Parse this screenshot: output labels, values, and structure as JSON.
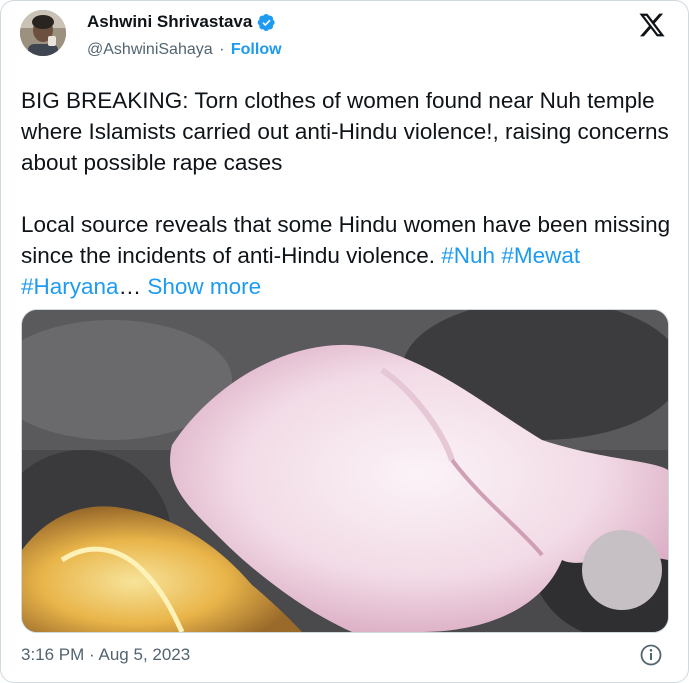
{
  "author": {
    "name": "Ashwini Shrivastava",
    "handle": "@AshwiniSahaya",
    "separator": "·",
    "follow_label": "Follow",
    "verified_color": "#1d9bf0"
  },
  "platform_icon": "x-logo-icon",
  "tweet": {
    "paragraph1": "BIG BREAKING: Torn clothes of women found near Nuh temple where Islamists carried out anti-Hindu violence!, raising concerns about possible rape cases",
    "paragraph2_text": "Local source reveals that some Hindu women have been missing since the incidents of anti-Hindu violence. ",
    "hashtags": [
      "#Nuh",
      "#Mewat",
      "#Haryana"
    ],
    "ellipsis": "…",
    "show_more_label": "Show more"
  },
  "media": {
    "kind": "video-still",
    "icon": "media-image"
  },
  "footer": {
    "time": "3:16 PM",
    "separator": "·",
    "date": "Aug 5, 2023",
    "info_icon": "info-icon"
  },
  "colors": {
    "accent": "#1d9bf0",
    "text": "#0f1419",
    "muted": "#536471",
    "border": "#cfd9de"
  }
}
